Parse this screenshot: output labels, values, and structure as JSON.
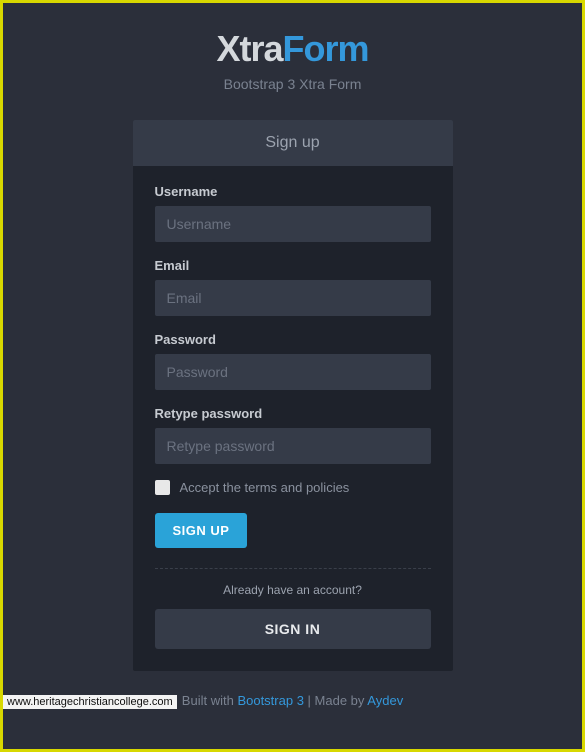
{
  "logo": {
    "part1": "Xtra",
    "part2": "Form"
  },
  "subtitle": "Bootstrap 3 Xtra Form",
  "tab": {
    "signup": "Sign up"
  },
  "form": {
    "username": {
      "label": "Username",
      "placeholder": "Username"
    },
    "email": {
      "label": "Email",
      "placeholder": "Email"
    },
    "password": {
      "label": "Password",
      "placeholder": "Password"
    },
    "retype": {
      "label": "Retype password",
      "placeholder": "Retype password"
    },
    "terms": "Accept the terms and policies",
    "signup_btn": "SIGN UP",
    "already": "Already have an account?",
    "signin_btn": "SIGN IN"
  },
  "footer": {
    "prefix": "Built with ",
    "link1": "Bootstrap 3",
    "middle": " | Made by ",
    "link2": "Aydev"
  },
  "watermark": "www.heritagechristiancollege.com"
}
